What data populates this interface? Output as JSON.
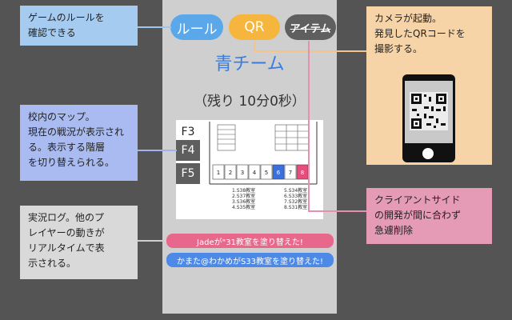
{
  "app": {
    "tabs": {
      "rule": "ルール",
      "qr": "QR",
      "item": "アイテム"
    },
    "team": "青チーム",
    "timer": "（残り 10分0秒）",
    "map": {
      "floors": [
        "F3",
        "F4",
        "F5"
      ],
      "active_floor": "F4",
      "room_numbers": [
        "1",
        "2",
        "3",
        "4",
        "5",
        "6",
        "7",
        "8"
      ],
      "room_colors": {
        "6": "#3a6fe0",
        "8": "#e94b7a"
      },
      "rooms_left": [
        "1.S38教室",
        "2.S37教室",
        "3.S36教室",
        "4.S35教室"
      ],
      "rooms_right": [
        "5.S34教室",
        "6.S33教室",
        "7.S32教室",
        "8.S31教室"
      ]
    },
    "logs": [
      {
        "text": "Jadeが\"31教室を塗り替えた!",
        "color": "#e8688c"
      },
      {
        "text": "かまた@わかめがS33教室を塗り替えた!",
        "color": "#4d8ae8"
      }
    ]
  },
  "notes": {
    "rule": "ゲームのルールを\n確認できる",
    "map": "校内のマップ。\n現在の戦況が表示され\nる。表示する階層\nを切り替えられる。",
    "log": "実況ログ。他のプ\nレイヤーの動きが\nリアルタイムで表\n示される。",
    "qr": "カメラが起動。\n発見したQRコードを\n撮影する。",
    "cut": "クライアントサイド\nの開発が間に合わず\n急遽削除"
  },
  "colors": {
    "background": "#545454",
    "phone": "#cfcfcf",
    "rule_tab": "#5aa8ea",
    "qr_tab": "#f6b63d",
    "item_tab": "#5f5f5f",
    "team_text": "#3a7be0"
  }
}
